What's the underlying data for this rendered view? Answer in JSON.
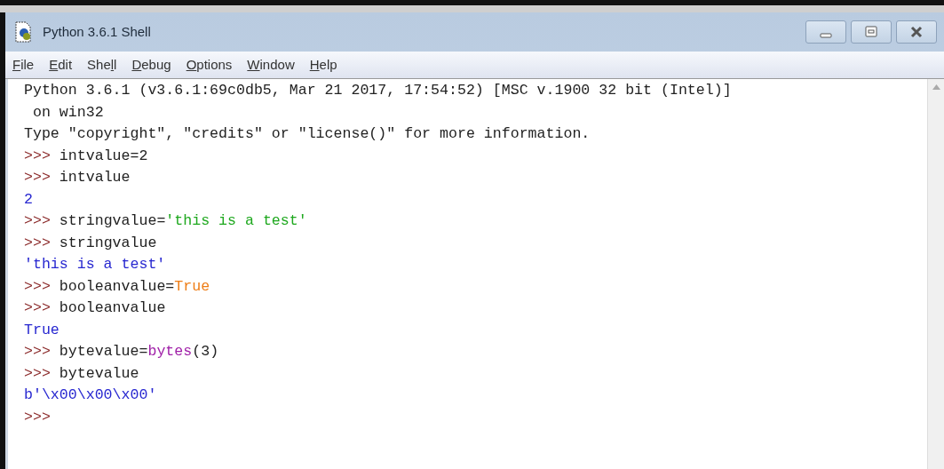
{
  "window": {
    "title": "Python 3.6.1 Shell"
  },
  "menu": [
    {
      "key": "F",
      "after": "ile"
    },
    {
      "key": "E",
      "after": "dit"
    },
    {
      "before": "She",
      "key": "l",
      "after": "l"
    },
    {
      "key": "D",
      "after": "ebug"
    },
    {
      "key": "O",
      "after": "ptions"
    },
    {
      "key": "W",
      "after": "indow"
    },
    {
      "key": "H",
      "after": "elp"
    }
  ],
  "lines": [
    [
      {
        "kind": "stdout",
        "text": "Python 3.6.1 (v3.6.1:69c0db5, Mar 21 2017, 17:54:52) [MSC v.1900 32 bit (Intel)]"
      }
    ],
    [
      {
        "kind": "stdout",
        "text": " on win32"
      }
    ],
    [
      {
        "kind": "stdout",
        "text": "Type \"copyright\", \"credits\" or \"license()\" for more information."
      }
    ],
    [
      {
        "kind": "prompt",
        "text": ">>> "
      },
      {
        "kind": "code",
        "text": "intvalue=2"
      }
    ],
    [
      {
        "kind": "prompt",
        "text": ">>> "
      },
      {
        "kind": "code",
        "text": "intvalue"
      }
    ],
    [
      {
        "kind": "output",
        "text": "2"
      }
    ],
    [
      {
        "kind": "prompt",
        "text": ">>> "
      },
      {
        "kind": "code",
        "text": "stringvalue="
      },
      {
        "kind": "string",
        "text": "'this is a test'"
      }
    ],
    [
      {
        "kind": "prompt",
        "text": ">>> "
      },
      {
        "kind": "code",
        "text": "stringvalue"
      }
    ],
    [
      {
        "kind": "output",
        "text": "'this is a test'"
      }
    ],
    [
      {
        "kind": "prompt",
        "text": ">>> "
      },
      {
        "kind": "code",
        "text": "booleanvalue="
      },
      {
        "kind": "keyword",
        "text": "True"
      }
    ],
    [
      {
        "kind": "prompt",
        "text": ">>> "
      },
      {
        "kind": "code",
        "text": "booleanvalue"
      }
    ],
    [
      {
        "kind": "output",
        "text": "True"
      }
    ],
    [
      {
        "kind": "prompt",
        "text": ">>> "
      },
      {
        "kind": "code",
        "text": "bytevalue="
      },
      {
        "kind": "builtin",
        "text": "bytes"
      },
      {
        "kind": "code",
        "text": "(3)"
      }
    ],
    [
      {
        "kind": "prompt",
        "text": ">>> "
      },
      {
        "kind": "code",
        "text": "bytevalue"
      }
    ],
    [
      {
        "kind": "output",
        "text": "b'\\x00\\x00\\x00'"
      }
    ],
    [
      {
        "kind": "prompt",
        "text": ">>>"
      }
    ]
  ]
}
